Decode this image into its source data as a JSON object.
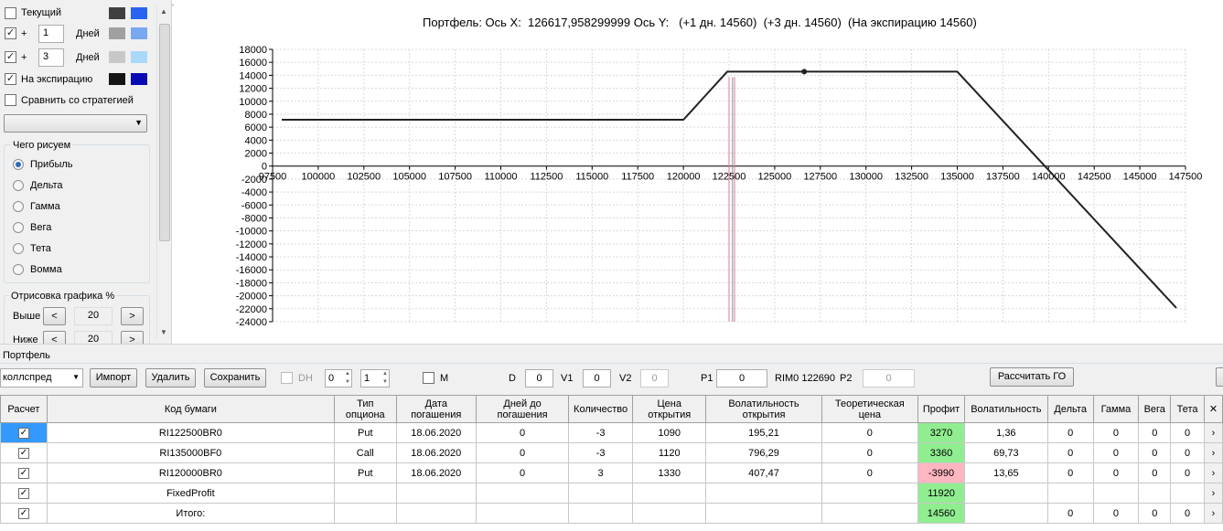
{
  "left": {
    "current": {
      "label": "Текущий",
      "checked": false,
      "colors": [
        "#404040",
        "#2864f0"
      ]
    },
    "plus1": {
      "prefix": "+",
      "value": "1",
      "unit": "Дней",
      "checked": true,
      "colors": [
        "#a0a0a0",
        "#78a8f0"
      ]
    },
    "plus3": {
      "prefix": "+",
      "value": "3",
      "unit": "Дней",
      "checked": true,
      "colors": [
        "#c8c8c8",
        "#aad8f8"
      ]
    },
    "expiry": {
      "label": "На экспирацию",
      "checked": true,
      "colors": [
        "#141414",
        "#0a0ab4"
      ]
    },
    "compare": {
      "label": "Сравнить со стратегией",
      "checked": false
    },
    "strategy_select": "",
    "draw_group": {
      "title": "Чего рисуем",
      "options": [
        "Прибыль",
        "Дельта",
        "Гамма",
        "Вега",
        "Тета",
        "Вомма"
      ],
      "selected": "Прибыль"
    },
    "render_group": {
      "title": "Отрисовка графика %",
      "above_label": "Выше",
      "above_value": "20",
      "below_label": "Ниже",
      "below_value": "20",
      "left_btn": "<",
      "right_btn": ">"
    }
  },
  "chart": {
    "title": "Портфель: Ось X:  126617,958299999 Ось Y:   (+1 дн. 14560)  (+3 дн. 14560)  (На экспирацию 14560)"
  },
  "chart_data": {
    "type": "line",
    "x_ticks": [
      "97500",
      "100000",
      "102500",
      "105000",
      "107500",
      "110000",
      "112500",
      "115000",
      "117500",
      "120000",
      "122500",
      "125000",
      "127500",
      "130000",
      "132500",
      "135000",
      "137500",
      "140000",
      "142500",
      "145000",
      "147500"
    ],
    "y_ticks": [
      "18000",
      "16000",
      "14000",
      "12000",
      "10000",
      "8000",
      "6000",
      "4000",
      "2000",
      "0",
      "-2000",
      "-4000",
      "-6000",
      "-8000",
      "-10000",
      "-12000",
      "-14000",
      "-16000",
      "-18000",
      "-20000",
      "-22000",
      "-24000"
    ],
    "xlim": [
      97500,
      147500
    ],
    "ylim": [
      -24000,
      18000
    ],
    "series": [
      {
        "x": [
          98000,
          120000,
          122400,
          135000,
          147000
        ],
        "y": [
          7140,
          7140,
          14560,
          14560,
          -21880
        ],
        "color": "#222222"
      }
    ],
    "marker": {
      "x": 126618,
      "y": 14560
    },
    "vlines": [
      {
        "x": 122500,
        "color": "#e07878"
      },
      {
        "x": 122690,
        "color": "#8888c0"
      },
      {
        "x": 122800,
        "color": "#e07878"
      }
    ]
  },
  "portfolio": {
    "title": "Портфель",
    "name": "коллспред",
    "import_label": "Импорт",
    "delete_label": "Удалить",
    "save_label": "Сохранить",
    "dh_label": "DH",
    "dh_value1": "0",
    "dh_value2": "1",
    "m_label": "M",
    "d_label": "D",
    "d_value": "0",
    "v1_label": "V1",
    "v1_value": "0",
    "v2_label": "V2",
    "v2_value": "0",
    "p1_label": "P1",
    "p1_value": "0",
    "rim_label": "RIM0 122690",
    "p2_label": "P2",
    "p2_value": "0",
    "calc_go_label": "Рассчитать ГО"
  },
  "table": {
    "headers": [
      "Расчет",
      "Код бумаги",
      "Тип опциона",
      "Дата погашения",
      "Дней до погашения",
      "Количество",
      "Цена открытия",
      "Волатильность открытия",
      "Теоретическая цена",
      "Профит",
      "Волатильность",
      "Дельта",
      "Гамма",
      "Вега",
      "Тета"
    ],
    "rows": [
      {
        "checked": true,
        "code": "RI122500BR0",
        "type": "Put",
        "date": "18.06.2020",
        "days": "0",
        "qty": "-3",
        "price": "1090",
        "vol_open": "195,21",
        "theo": "0",
        "profit": "3270",
        "profit_color": "green",
        "vol": "1,36",
        "delta": "0",
        "gamma": "0",
        "vega": "0",
        "theta": "0"
      },
      {
        "checked": true,
        "code": "RI135000BF0",
        "type": "Call",
        "date": "18.06.2020",
        "days": "0",
        "qty": "-3",
        "price": "1120",
        "vol_open": "796,29",
        "theo": "0",
        "profit": "3360",
        "profit_color": "green",
        "vol": "69,73",
        "delta": "0",
        "gamma": "0",
        "vega": "0",
        "theta": "0"
      },
      {
        "checked": true,
        "code": "RI120000BR0",
        "type": "Put",
        "date": "18.06.2020",
        "days": "0",
        "qty": "3",
        "price": "1330",
        "vol_open": "407,47",
        "theo": "0",
        "profit": "-3990",
        "profit_color": "red",
        "vol": "13,65",
        "delta": "0",
        "gamma": "0",
        "vega": "0",
        "theta": "0"
      },
      {
        "checked": true,
        "code": "FixedProfit",
        "type": "",
        "date": "",
        "days": "",
        "qty": "",
        "price": "",
        "vol_open": "",
        "theo": "",
        "profit": "11920",
        "profit_color": "green",
        "vol": "",
        "delta": "",
        "gamma": "",
        "vega": "",
        "theta": ""
      },
      {
        "checked": true,
        "code": "Итого:",
        "type": "",
        "date": "",
        "days": "",
        "qty": "",
        "price": "",
        "vol_open": "",
        "theo": "",
        "profit": "14560",
        "profit_color": "green",
        "vol": "",
        "delta": "0",
        "gamma": "0",
        "vega": "0",
        "theta": "0"
      }
    ]
  }
}
